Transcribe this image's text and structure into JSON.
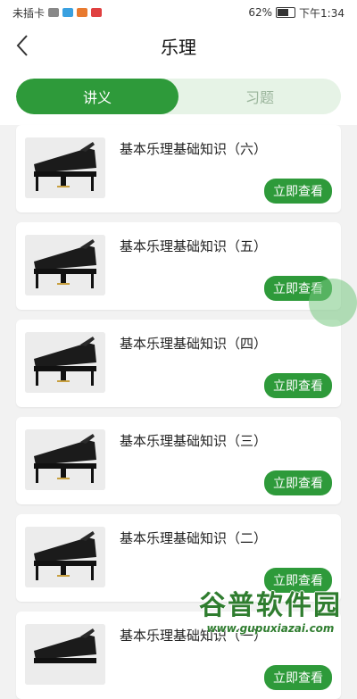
{
  "status_bar": {
    "left_text": "未插卡",
    "battery": "62%",
    "time": "下午1:34"
  },
  "header": {
    "title": "乐理"
  },
  "tabs": [
    {
      "label": "讲义",
      "active": true
    },
    {
      "label": "习题",
      "active": false
    }
  ],
  "items": [
    {
      "title": "基本乐理基础知识（六）",
      "button": "立即查看"
    },
    {
      "title": "基本乐理基础知识（五）",
      "button": "立即查看"
    },
    {
      "title": "基本乐理基础知识（四）",
      "button": "立即查看"
    },
    {
      "title": "基本乐理基础知识（三）",
      "button": "立即查看"
    },
    {
      "title": "基本乐理基础知识（二）",
      "button": "立即查看"
    },
    {
      "title": "基本乐理基础知识（一）",
      "button": "立即查看"
    }
  ],
  "watermark": {
    "main": "谷普软件园",
    "sub": "www.gupuxiazai.com"
  },
  "colors": {
    "accent": "#2e9a3a",
    "tab_inactive_bg": "#e6f3e6"
  }
}
